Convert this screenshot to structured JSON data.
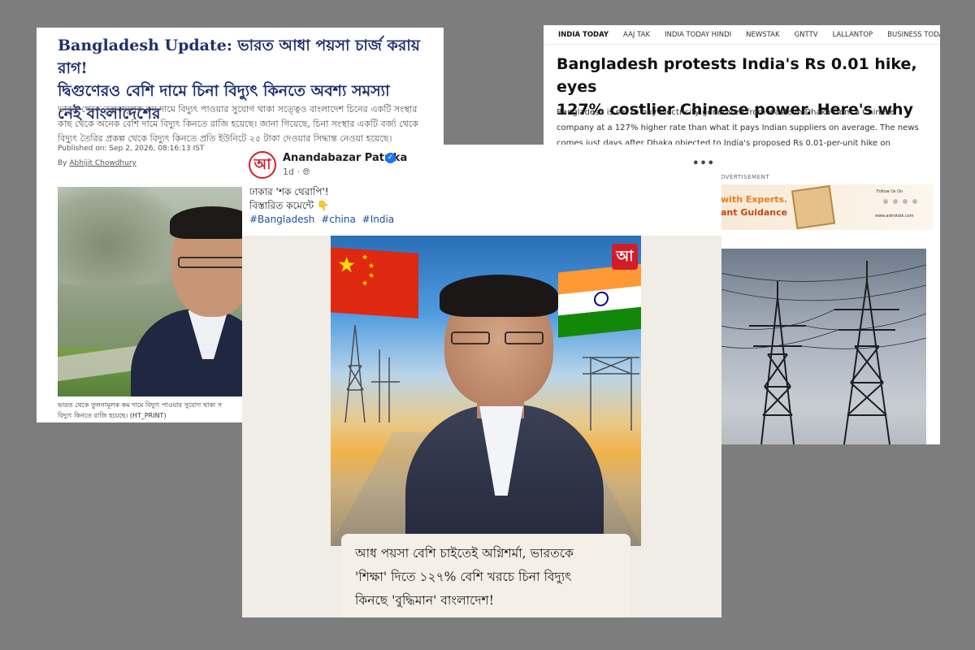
{
  "left_article": {
    "headline_prefix": "Bangladesh Update:",
    "headline_line1_bn": "ভারত আধা পয়সা চার্জ করায় রাগ!",
    "headline_line2": "দ্বিগুণেরও বেশি দামে চিনা বিদ্যুৎ কিনতে অবশ্য সমস্যা",
    "headline_line3": "নেই বাংলাদেশের",
    "summary_line1": "ভারত থেকে তুলনামূলক কম দামে বিদ্যুৎ পাওয়ার সুযোগ থাকা সত্ত্বেও বাংলাদেশ চিনের একটি সংস্থার",
    "summary_line2": "কাছ থেকে অনেক বেশি দামে বিদ্যুৎ কিনতে রাজি হয়েছে। জানা গিয়েছে, চিনা সংস্থার একটি বর্জ্য থেকে",
    "summary_line3": "বিদ্যুৎ তৈরির প্রকল্প থেকে বিদ্যুৎ কিনতে প্রতি ইউনিটে ২৫ টাকা দেওয়ার সিদ্ধান্ত নেওয়া হয়েছে।",
    "published": "Published on: Sep 2, 2026, 08:16:13 IST",
    "byline_prefix": "By",
    "author": "Abhijit Chowdhury",
    "photo_caption_line1": "ভারত থেকে তুলনামূলক কম দামে বিদ্যুৎ পাওয়ার সুযোগ থাকা স",
    "photo_caption_line2": "বিদ্যুৎ কিনতে রাজি হয়েছে। (HT_PRINT)"
  },
  "right_article": {
    "nav": [
      "INDIA TODAY",
      "AAJ TAK",
      "INDIA TODAY HINDI",
      "NEWSTAK",
      "GNTTV",
      "LALLANTOP",
      "BUSINESS TODAY"
    ],
    "headline_line1": "Bangladesh protests India's Rs 0.01 hike, eyes",
    "headline_line2": "127% costlier Chinese power. Here's why",
    "summary_line1": "Bangladesh is set to buy electricity generated from waste in Dhaka from a Chinese",
    "summary_line2": "company at a 127% higher rate than what it pays Indian suppliers on average. The news",
    "summary_line3": "comes just days after Dhaka objected to India's proposed Rs 0.01-per-unit hike on",
    "ad_label": "DVERTISEMENT",
    "ad_text1": "with Experts.",
    "ad_text2": "ant Guidance",
    "ad_follow": "Follow Us On",
    "ad_url": "www.astrotalk.com"
  },
  "facebook_post": {
    "avatar_letter": "আ",
    "page_name": "Anandabazar Patrika",
    "verified_mark": "✓",
    "time": "1d",
    "privacy_icon": "globe-icon",
    "more_label": "•••",
    "text_line1": "ঢাকার 'শক থেরাপি'!",
    "text_line2": "বিস্তারিত কমেন্টে 👇",
    "hashtags": [
      "#Bangladesh",
      "#china",
      "#India"
    ],
    "image_logo": "আ",
    "image_caption_line1": "আধ পয়সা বেশি চাইতেই অগ্নিশর্মা, ভারতকে",
    "image_caption_line2": "'শিক্ষা' দিতে ১২৭% বেশি খরচে চিনা বিদ্যুৎ",
    "image_caption_line3": "কিনছে 'বুদ্ধিমান' বাংলাদেশ!"
  },
  "colors": {
    "background": "#7d7d7d",
    "left_headline": "#1f2f6e",
    "hashtag": "#1b4fa0",
    "brand_red": "#d31c2a",
    "verified_blue": "#1877f2"
  }
}
